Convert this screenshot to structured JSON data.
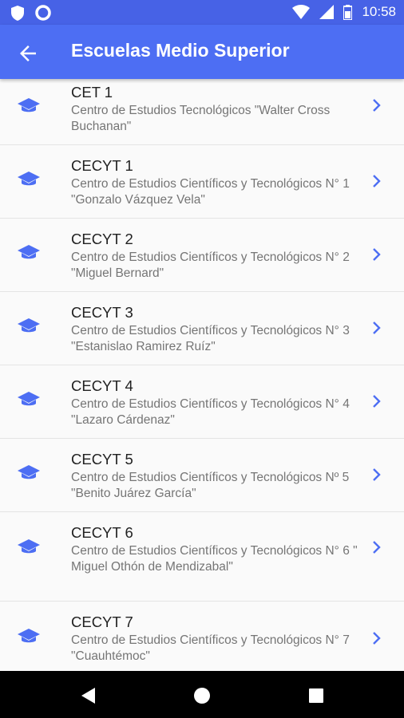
{
  "status_bar": {
    "time": "10:58",
    "left_icons": [
      "shield-icon",
      "circle-icon"
    ],
    "right_icons": [
      "wifi-icon",
      "signal-icon",
      "battery-icon"
    ]
  },
  "app_bar": {
    "back_icon": "arrow-back-icon",
    "title": "Escuelas Medio Superior",
    "color": "#4d6ef3"
  },
  "schools": [
    {
      "name": "CET 1",
      "description": "Centro de Estudios Tecnológicos \"Walter Cross Buchanan\""
    },
    {
      "name": "CECYT 1",
      "description": "Centro de Estudios Científicos y Tecnológicos N° 1 \"Gonzalo Vázquez Vela\""
    },
    {
      "name": "CECYT 2",
      "description": "Centro de Estudios Científicos y Tecnológicos N° 2 \"Miguel Bernard\""
    },
    {
      "name": "CECYT 3",
      "description": "Centro de Estudios Científicos y Tecnológicos N° 3 \"Estanislao Ramirez Ruíz\""
    },
    {
      "name": "CECYT 4",
      "description": "Centro de Estudios Científicos y Tecnológicos N° 4 \"Lazaro Cárdenaz\""
    },
    {
      "name": "CECYT 5",
      "description": "Centro de Estudios Científicos y Tecnológicos Nº 5 \"Benito Juárez García\""
    },
    {
      "name": "CECYT 6",
      "description": "Centro de Estudios Científicos y Tecnológicos N° 6 \" Miguel Othón de Mendizabal\""
    },
    {
      "name": "CECYT 7",
      "description": "Centro de Estudios Científicos y Tecnológicos N° 7 \"Cuauhtémoc\""
    }
  ],
  "item_icon": "graduation-cap-icon",
  "item_chevron": "chevron-right-icon",
  "accent_color": "#4d6ef3",
  "nav_bar": {
    "buttons": [
      "back-triangle-icon",
      "home-circle-icon",
      "recents-square-icon"
    ]
  }
}
